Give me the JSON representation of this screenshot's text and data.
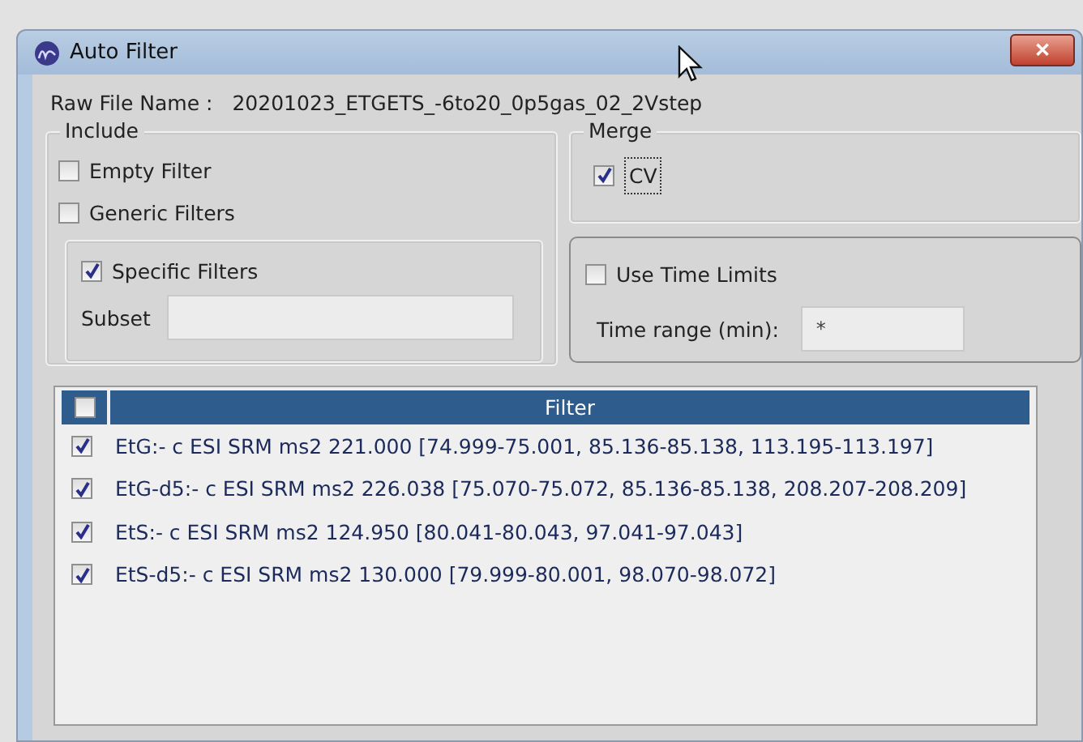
{
  "window": {
    "title": "Auto Filter",
    "close": "✕"
  },
  "raw_file": {
    "label": "Raw File Name :",
    "value": "20201023_ETGETS_-6to20_0p5gas_02_2Vstep"
  },
  "include": {
    "title": "Include",
    "options": [
      {
        "label": "Empty Filter",
        "checked": false
      },
      {
        "label": "Generic Filters",
        "checked": false
      }
    ],
    "specific": {
      "label": "Specific Filters",
      "checked": true
    },
    "subset": {
      "label": "Subset"
    }
  },
  "merge": {
    "title": "Merge",
    "option": {
      "label": "CV",
      "checked": true,
      "focused": true
    }
  },
  "time_limits": {
    "label": "Use Time Limits",
    "checked": false,
    "range_label": "Time range (min):",
    "range_value": "*"
  },
  "table": {
    "header_checked": false,
    "columns": [
      "Filter"
    ],
    "rows": [
      {
        "checked": true,
        "filter": "EtG:- c ESI SRM ms2 221.000 [74.999-75.001, 85.136-85.138, 113.195-113.197]"
      },
      {
        "checked": true,
        "filter": "EtG-d5:- c ESI SRM ms2 226.038 [75.070-75.072, 85.136-85.138, 208.207-208.209]"
      },
      {
        "checked": true,
        "filter": "EtS:- c ESI SRM ms2 124.950 [80.041-80.043, 97.041-97.043]"
      },
      {
        "checked": true,
        "filter": "EtS-d5:- c ESI SRM ms2 130.000 [79.999-80.001, 98.070-98.072]"
      }
    ]
  }
}
